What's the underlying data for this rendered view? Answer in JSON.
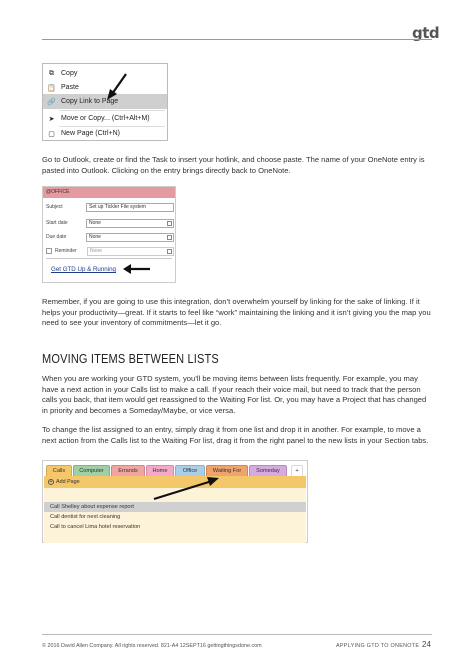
{
  "header": {
    "logo": "gtd"
  },
  "context_menu": {
    "items": [
      {
        "label": "Copy",
        "icon": "copy-icon"
      },
      {
        "label": "Paste",
        "icon": "paste-icon"
      },
      {
        "label": "Copy Link to Page",
        "icon": "link-icon",
        "highlighted": true
      },
      {
        "label": "Move or Copy...",
        "shortcut": "(Ctrl+Alt+M)",
        "icon": "move-icon"
      },
      {
        "label": "New Page",
        "shortcut": "(Ctrl+N)",
        "icon": "new-page-icon"
      }
    ]
  },
  "paragraphs": {
    "p1": "Go to Outlook, create or find the Task to insert your hotlink, and choose paste. The name of your OneNote entry is pasted into Outlook. Clicking on the entry brings directly back to OneNote.",
    "p2": "Remember, if you are going to use this integration, don’t overwhelm yourself by linking for the sake of linking. If it helps your productivity—great. If it starts to feel like “work” maintaining the linking and it isn’t giving you the map you need to see your inventory of commitments—let it go.",
    "p3": "When you are working your GTD system, you’ll be moving items between lists frequently. For example, you may have a next action in your Calls list to make a call. If your reach their voice mail, but need to track that the person calls you back, that item would get reassigned to the Waiting For list. Or, you may have a Project that has changed in priority and becomes a Someday/Maybe, or vice versa.",
    "p4": "To change the list assigned to an entry, simply drag it from one list and drop it in another. For example, to move a next action from the Calls list to the Waiting For list, drag it from the right panel to the new lists in your Section tabs."
  },
  "heading": "MOVING ITEMS BETWEEN LISTS",
  "task_form": {
    "category": "@OFFICE",
    "subject_label": "Subject",
    "subject_value": "Set up Tickler File system",
    "start_label": "Start date",
    "start_value": "None",
    "due_label": "Due date",
    "due_value": "None",
    "reminder_label": "Reminder",
    "reminder_value": "None",
    "link_text": "Get GTD Up & Running"
  },
  "onenote": {
    "tabs": [
      {
        "label": "Calls",
        "color": "#f4c76a"
      },
      {
        "label": "Computer",
        "color": "#9fcfa3"
      },
      {
        "label": "Errands",
        "color": "#f2a4a0"
      },
      {
        "label": "Home",
        "color": "#f3a9c8"
      },
      {
        "label": "Office",
        "color": "#a9cfe8"
      },
      {
        "label": "Waiting For",
        "color": "#f0a36c"
      },
      {
        "label": "Someday",
        "color": "#d6a9e0"
      },
      {
        "label": "+",
        "color": "#ffffff"
      }
    ],
    "add_page": "Add Page",
    "pages": [
      "Call Shelley about expense report",
      "Call dentist for next cleaning",
      "Call to cancel Lima hotel reservation"
    ]
  },
  "footer": {
    "left": "© 2016 David Allen Company. All rights reserved.  821-A4  12SEPT16   gettingthingsdone.com",
    "right": "APPLYING GTD TO ONENOTE",
    "page_number": "24"
  }
}
